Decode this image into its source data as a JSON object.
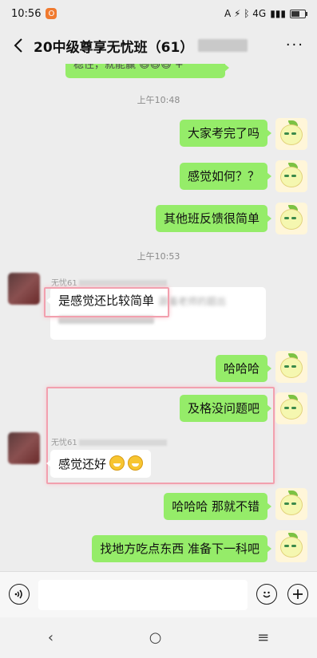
{
  "status_bar": {
    "time": "10:56",
    "app_badge": "O",
    "signal_text": "A ⚡ ᛒ 4G",
    "wifi_icon": "wifi-icon"
  },
  "header": {
    "back_icon": "‹",
    "title": "20中级尊享无忧班（61）",
    "more_icon": "···"
  },
  "top_partial": {
    "text": "稳住，就能赢 😄😄😄 +"
  },
  "messages": {
    "time1": "上午10:48",
    "m1": "大家考完了吗",
    "m2": "感觉如何？？",
    "m3": "其他班反馈很简单",
    "time2": "上午10:53",
    "sender1": "无忧61",
    "o1_line1": "是感觉还比较简单",
    "o1_blur": "跟着老师的题出",
    "m4": "哈哈哈",
    "m5": "及格没问题吧",
    "sender2": "无忧61",
    "o2": "感觉还好",
    "m6": "哈哈哈  那就不错",
    "m7": "找地方吃点东西 准备下一科吧"
  },
  "input_bar": {
    "voice_icon": "voice-icon",
    "emoji_icon": "emoji-icon",
    "plus_icon": "plus-icon"
  },
  "nav": {
    "back": "‹",
    "home": "○",
    "menu": "≡"
  }
}
